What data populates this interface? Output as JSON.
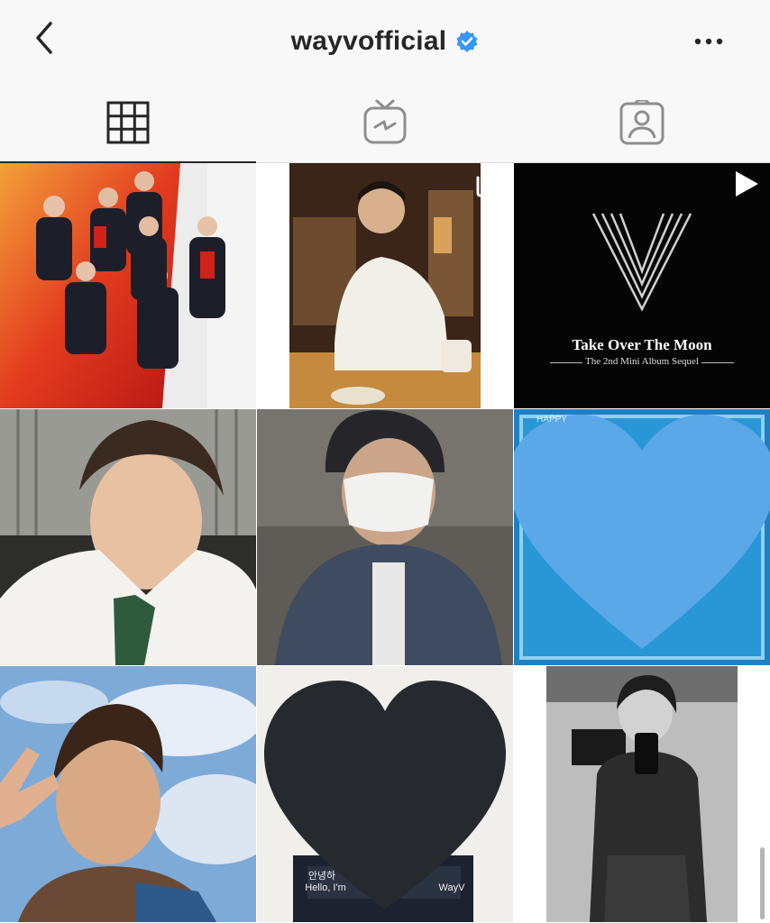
{
  "header": {
    "back_icon": "chevron-left-icon",
    "username": "wayvofficial",
    "verified_icon": "verified-badge-icon",
    "more_icon": "more-horizontal-icon"
  },
  "tabs": [
    {
      "icon": "grid-icon",
      "active": true
    },
    {
      "icon": "igtv-icon",
      "active": false
    },
    {
      "icon": "tagged-icon",
      "active": false
    }
  ],
  "posts": [
    {
      "type": "photo",
      "subject": "group"
    },
    {
      "type": "carousel",
      "subject": "person-cafe",
      "overlay_icon": "multiple-posts-icon"
    },
    {
      "type": "video",
      "subject": "album-art",
      "overlay_icon": "play-icon",
      "title": "Take Over The Moon",
      "subtitle": "The 2nd Mini Album Sequel"
    },
    {
      "type": "photo",
      "subject": "portrait-uniform"
    },
    {
      "type": "photo",
      "subject": "masked-selfie"
    },
    {
      "type": "photo",
      "subject": "heart-covered-blue",
      "heart_color": "#5aa8e8",
      "caption": "HAPPY"
    },
    {
      "type": "photo",
      "subject": "peace-sign-sky"
    },
    {
      "type": "photo",
      "subject": "heart-covered-dark",
      "heart_color": "#26292d",
      "caption_line1": "안녕하",
      "caption_line2": "Hello, I'm",
      "caption_tail": "WayV"
    },
    {
      "type": "photo",
      "subject": "mirror-selfie-bw"
    }
  ],
  "colors": {
    "header_bg": "#f8f8f8",
    "text": "#262626",
    "verified": "#3897f0"
  }
}
